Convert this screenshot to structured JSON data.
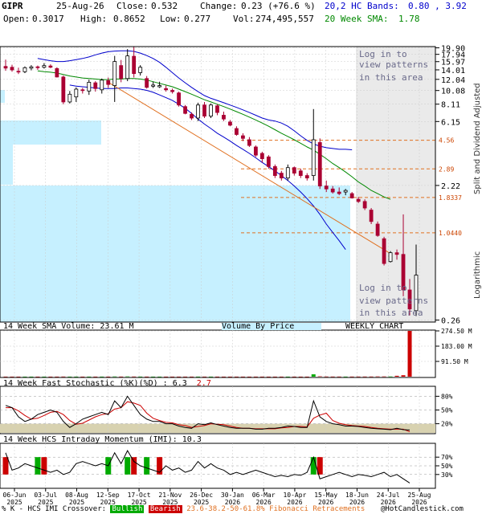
{
  "header": {
    "symbol": "GIPR",
    "date": "25-Aug-26",
    "close_label": "Close:",
    "close": "0.532",
    "change_label": "Change:",
    "change": "0.23 (+76.6 %)",
    "open_label": "Open:",
    "open": "0.3017",
    "high_label": "High:",
    "high": "0.8652",
    "low_label": "Low:",
    "low": "0.277",
    "vol_label": "Vol:",
    "vol": "274,495,557",
    "bands_label": "20,2 HC Bands:",
    "bands": "0.80 , 3.92",
    "sma_label": "20 Week SMA:",
    "sma": "1.78"
  },
  "overlay_text": {
    "login_top": [
      "Log in to",
      "view patterns",
      "in this area"
    ],
    "login_bottom": [
      "Log in to",
      "view patterns",
      "in this area"
    ]
  },
  "side_labels": {
    "adjusted": "Split and Dividend Adjusted",
    "log": "Logarithmic"
  },
  "panel_titles": {
    "volume": "14 Week SMA Volume: 23.61 M",
    "vbp": "Volume By Price",
    "weekly": "WEEKLY CHART",
    "stoch_prefix": "14 Week Fast Stochastic (%K)(%D) : ",
    "stoch_k": "6.3",
    "stoch_d": "2.7",
    "imi": "14 Week HCS Intraday Momentum (IMI): 10.3"
  },
  "footer": {
    "prefix": "% K - HCS IMI Crossover:",
    "bullish": "Bullish",
    "bearish": "Bearish",
    "fib": "23.6-38.2-50-61.8% Fibonacci Retracements",
    "copyright": "@HotCandlestick.com"
  },
  "colors": {
    "up": "#ffffff",
    "down": "#aa0033",
    "bands": "#0000cc",
    "sma": "#008800",
    "trend": "#e07020",
    "vbp": "#c6f0ff",
    "bullish": "#00aa00",
    "bearish": "#cc0000"
  },
  "chart_data": [
    {
      "type": "candlestick",
      "scale": "log",
      "price_ticks": [
        "19.90",
        "17.94",
        "15.97",
        "14.01",
        "12.04",
        "10.08",
        "8.11",
        "6.15",
        "2.22",
        "0.26"
      ],
      "price_tick_values": [
        19.9,
        17.94,
        15.97,
        14.01,
        12.04,
        10.08,
        8.11,
        6.15,
        2.22,
        0.26
      ],
      "fib_levels": [
        {
          "label": "4.56",
          "value": 4.56
        },
        {
          "label": "2.89",
          "value": 2.89
        },
        {
          "label": "1.8337",
          "value": 1.8337
        },
        {
          "label": "1.0440",
          "value": 1.044
        }
      ],
      "x_labels": [
        "06-Jun 2025",
        "03-Jul 2025",
        "08-Aug 2025",
        "12-Sep 2025",
        "17-Oct 2025",
        "21-Nov 2025",
        "26-Dec 2025",
        "30-Jan 2026",
        "06-Mar 2026",
        "10-Apr 2026",
        "15-May 2026",
        "18-Jun 2026",
        "24-Jul 2026",
        "25-Aug 2026"
      ],
      "candles": [
        {
          "o": 14.8,
          "h": 16.5,
          "l": 13.8,
          "c": 14.4
        },
        {
          "o": 14.6,
          "h": 15.2,
          "l": 13.6,
          "c": 14.0
        },
        {
          "o": 13.7,
          "h": 14.5,
          "l": 13.1,
          "c": 13.6
        },
        {
          "o": 13.6,
          "h": 14.8,
          "l": 13.3,
          "c": 14.5
        },
        {
          "o": 14.4,
          "h": 15.1,
          "l": 13.9,
          "c": 14.7
        },
        {
          "o": 14.7,
          "h": 15.0,
          "l": 14.0,
          "c": 14.5
        },
        {
          "o": 14.6,
          "h": 15.6,
          "l": 14.3,
          "c": 15.0
        },
        {
          "o": 14.9,
          "h": 15.3,
          "l": 14.4,
          "c": 14.6
        },
        {
          "o": 14.3,
          "h": 14.6,
          "l": 12.4,
          "c": 12.5
        },
        {
          "o": 12.5,
          "h": 12.8,
          "l": 8.1,
          "c": 8.4
        },
        {
          "o": 8.4,
          "h": 10.0,
          "l": 8.2,
          "c": 9.5
        },
        {
          "o": 9.1,
          "h": 10.6,
          "l": 8.4,
          "c": 10.3
        },
        {
          "o": 10.2,
          "h": 10.5,
          "l": 9.6,
          "c": 10.1
        },
        {
          "o": 10.0,
          "h": 12.0,
          "l": 9.4,
          "c": 11.5
        },
        {
          "o": 11.4,
          "h": 11.7,
          "l": 9.9,
          "c": 10.4
        },
        {
          "o": 10.2,
          "h": 12.2,
          "l": 9.6,
          "c": 11.9
        },
        {
          "o": 11.8,
          "h": 12.4,
          "l": 10.5,
          "c": 11.1
        },
        {
          "o": 10.9,
          "h": 17.5,
          "l": 8.4,
          "c": 16.0
        },
        {
          "o": 15.0,
          "h": 16.4,
          "l": 11.5,
          "c": 12.2
        },
        {
          "o": 12.2,
          "h": 19.5,
          "l": 11.7,
          "c": 17.5
        },
        {
          "o": 17.4,
          "h": 20.3,
          "l": 12.4,
          "c": 13.2
        },
        {
          "o": 13.4,
          "h": 15.1,
          "l": 12.8,
          "c": 14.6
        },
        {
          "o": 12.2,
          "h": 12.7,
          "l": 10.4,
          "c": 10.6
        },
        {
          "o": 10.8,
          "h": 11.6,
          "l": 10.5,
          "c": 11.0
        },
        {
          "o": 10.7,
          "h": 11.6,
          "l": 10.5,
          "c": 10.9
        },
        {
          "o": 10.4,
          "h": 10.9,
          "l": 9.9,
          "c": 10.2
        },
        {
          "o": 10.1,
          "h": 10.4,
          "l": 9.6,
          "c": 9.9
        },
        {
          "o": 9.7,
          "h": 9.9,
          "l": 7.8,
          "c": 8.0
        },
        {
          "o": 7.8,
          "h": 8.0,
          "l": 6.9,
          "c": 7.0
        },
        {
          "o": 6.9,
          "h": 7.1,
          "l": 6.3,
          "c": 6.5
        },
        {
          "o": 6.5,
          "h": 8.3,
          "l": 6.2,
          "c": 8.0
        },
        {
          "o": 8.0,
          "h": 8.4,
          "l": 6.5,
          "c": 6.7
        },
        {
          "o": 6.7,
          "h": 8.2,
          "l": 6.5,
          "c": 8.0
        },
        {
          "o": 7.9,
          "h": 8.1,
          "l": 6.8,
          "c": 7.1
        },
        {
          "o": 6.8,
          "h": 7.2,
          "l": 6.2,
          "c": 6.4
        },
        {
          "o": 6.1,
          "h": 6.3,
          "l": 5.7,
          "c": 5.8
        },
        {
          "o": 5.5,
          "h": 5.7,
          "l": 4.9,
          "c": 5.0
        },
        {
          "o": 4.9,
          "h": 5.1,
          "l": 4.5,
          "c": 4.7
        },
        {
          "o": 4.6,
          "h": 4.8,
          "l": 4.1,
          "c": 4.2
        },
        {
          "o": 4.1,
          "h": 4.2,
          "l": 3.5,
          "c": 3.6
        },
        {
          "o": 3.7,
          "h": 3.8,
          "l": 3.2,
          "c": 3.4
        },
        {
          "o": 3.5,
          "h": 3.6,
          "l": 2.9,
          "c": 3.0
        },
        {
          "o": 3.0,
          "h": 3.1,
          "l": 2.5,
          "c": 2.6
        },
        {
          "o": 2.7,
          "h": 2.8,
          "l": 2.4,
          "c": 2.5
        },
        {
          "o": 2.5,
          "h": 3.1,
          "l": 2.4,
          "c": 2.95
        },
        {
          "o": 2.95,
          "h": 3.0,
          "l": 2.6,
          "c": 2.7
        },
        {
          "o": 2.8,
          "h": 2.9,
          "l": 2.5,
          "c": 2.6
        },
        {
          "o": 2.6,
          "h": 2.7,
          "l": 2.4,
          "c": 2.5
        },
        {
          "o": 2.6,
          "h": 7.5,
          "l": 2.4,
          "c": 4.6
        },
        {
          "o": 4.4,
          "h": 4.7,
          "l": 2.1,
          "c": 2.2
        },
        {
          "o": 2.2,
          "h": 2.4,
          "l": 2.0,
          "c": 2.1
        },
        {
          "o": 2.1,
          "h": 2.2,
          "l": 1.95,
          "c": 2.0
        },
        {
          "o": 2.0,
          "h": 2.15,
          "l": 1.9,
          "c": 1.95
        },
        {
          "o": 2.0,
          "h": 2.1,
          "l": 1.9,
          "c": 2.05
        },
        {
          "o": 1.95,
          "h": 2.0,
          "l": 1.8,
          "c": 1.82
        },
        {
          "o": 1.78,
          "h": 1.85,
          "l": 1.68,
          "c": 1.72
        },
        {
          "o": 1.72,
          "h": 1.78,
          "l": 1.5,
          "c": 1.55
        },
        {
          "o": 1.5,
          "h": 1.55,
          "l": 1.2,
          "c": 1.25
        },
        {
          "o": 1.2,
          "h": 1.25,
          "l": 0.98,
          "c": 1.0
        },
        {
          "o": 0.95,
          "h": 0.98,
          "l": 0.62,
          "c": 0.64
        },
        {
          "o": 0.66,
          "h": 0.78,
          "l": 0.65,
          "c": 0.76
        },
        {
          "o": 0.76,
          "h": 0.8,
          "l": 0.68,
          "c": 0.74
        },
        {
          "o": 0.74,
          "h": 1.4,
          "l": 0.38,
          "c": 0.42
        },
        {
          "o": 0.42,
          "h": 0.5,
          "l": 0.28,
          "c": 0.31
        },
        {
          "o": 0.3017,
          "h": 0.8652,
          "l": 0.277,
          "c": 0.532
        }
      ],
      "sma20": [
        null,
        null,
        null,
        null,
        null,
        13.8,
        13.6,
        13.5,
        13.3,
        13.0,
        12.7,
        12.5,
        12.3,
        12.2,
        12.1,
        12.0,
        12.0,
        12.1,
        12.1,
        12.2,
        12.2,
        12.1,
        11.9,
        11.6,
        11.3,
        11.0,
        10.7,
        10.3,
        9.9,
        9.5,
        9.1,
        8.7,
        8.4,
        8.1,
        7.8,
        7.5,
        7.2,
        6.9,
        6.6,
        6.3,
        6.0,
        5.7,
        5.4,
        5.1,
        4.85,
        4.6,
        4.35,
        4.1,
        3.9,
        3.65,
        3.4,
        3.15,
        2.95,
        2.75,
        2.55,
        2.35,
        2.2,
        2.05,
        1.95,
        1.85,
        1.78
      ],
      "hc_upper": [
        null,
        null,
        null,
        null,
        null,
        16.8,
        16.5,
        16.2,
        16.0,
        16.0,
        16.2,
        16.5,
        16.8,
        17.2,
        17.8,
        18.3,
        18.7,
        18.9,
        19.0,
        19.0,
        18.8,
        18.3,
        17.6,
        16.8,
        15.8,
        14.6,
        13.4,
        12.3,
        11.4,
        10.6,
        9.9,
        9.3,
        8.9,
        8.6,
        8.3,
        8.0,
        7.7,
        7.4,
        7.1,
        6.8,
        6.5,
        6.3,
        6.2,
        6.0,
        5.7,
        5.3,
        4.9,
        4.55,
        4.3,
        4.15,
        4.05,
        4.0,
        3.95,
        3.95,
        3.92
      ],
      "hc_lower": [
        null,
        null,
        null,
        null,
        null,
        11.0,
        10.8,
        10.7,
        10.6,
        10.5,
        10.4,
        10.4,
        10.4,
        10.5,
        10.5,
        10.4,
        10.3,
        10.1,
        9.8,
        9.4,
        9.0,
        8.6,
        8.1,
        7.6,
        7.0,
        6.4,
        5.9,
        5.5,
        5.1,
        4.8,
        4.5,
        4.2,
        3.95,
        3.7,
        3.45,
        3.2,
        3.0,
        2.8,
        2.6,
        2.4,
        2.2,
        2.0,
        1.8,
        1.6,
        1.4,
        1.2,
        1.05,
        0.92,
        0.8
      ],
      "volume": [
        0.4,
        0.3,
        0.3,
        0.3,
        0.3,
        0.3,
        0.3,
        0.3,
        0.4,
        0.8,
        0.4,
        0.4,
        0.3,
        0.5,
        0.4,
        0.5,
        0.4,
        1.2,
        0.7,
        1.5,
        1.0,
        0.6,
        0.5,
        0.4,
        0.4,
        0.3,
        0.3,
        0.4,
        0.4,
        0.3,
        0.5,
        0.4,
        0.4,
        0.4,
        0.3,
        0.3,
        0.4,
        0.4,
        0.3,
        0.4,
        0.3,
        0.3,
        0.3,
        0.3,
        0.4,
        0.3,
        0.3,
        0.3,
        14.0,
        2.0,
        1.0,
        0.8,
        0.8,
        0.6,
        0.7,
        0.8,
        0.9,
        1.0,
        1.5,
        1.4,
        1.2,
        5.2,
        8.5,
        274.5
      ],
      "volume_ticks": [
        "274.50 M",
        "183.00 M",
        "91.50 M"
      ],
      "volume_tick_values": [
        274.5,
        183.0,
        91.5
      ],
      "stoch_k": [
        60,
        55,
        35,
        25,
        30,
        40,
        45,
        50,
        45,
        25,
        12,
        20,
        30,
        35,
        40,
        45,
        40,
        70,
        55,
        80,
        60,
        40,
        30,
        25,
        25,
        20,
        20,
        15,
        12,
        10,
        20,
        18,
        22,
        18,
        15,
        12,
        10,
        10,
        10,
        8,
        8,
        10,
        10,
        12,
        15,
        14,
        12,
        12,
        70,
        35,
        25,
        20,
        18,
        15,
        15,
        14,
        12,
        10,
        9,
        8,
        7,
        10,
        7,
        6.3
      ],
      "stoch_d": [
        55,
        55,
        48,
        38,
        30,
        32,
        38,
        45,
        47,
        40,
        27,
        19,
        21,
        28,
        35,
        40,
        42,
        52,
        55,
        68,
        65,
        60,
        43,
        32,
        27,
        23,
        22,
        18,
        16,
        12,
        14,
        16,
        20,
        19,
        18,
        15,
        12,
        10,
        10,
        9,
        9,
        9,
        9,
        11,
        12,
        14,
        14,
        13,
        32,
        39,
        43,
        27,
        21,
        18,
        16,
        15,
        14,
        12,
        10,
        9,
        8,
        8,
        8,
        2.7
      ],
      "stoch_ticks": [
        "80%",
        "50%",
        "20%"
      ],
      "imi": [
        80,
        40,
        45,
        55,
        50,
        45,
        40,
        35,
        40,
        30,
        35,
        55,
        60,
        55,
        50,
        55,
        50,
        80,
        55,
        85,
        60,
        50,
        45,
        40,
        35,
        50,
        40,
        45,
        35,
        40,
        60,
        45,
        55,
        45,
        40,
        30,
        35,
        30,
        35,
        40,
        35,
        30,
        25,
        28,
        25,
        30,
        28,
        35,
        70,
        20,
        25,
        30,
        35,
        30,
        25,
        30,
        28,
        25,
        30,
        35,
        25,
        30,
        20,
        10.3
      ],
      "imi_ticks": [
        "70%",
        "50%",
        "30%"
      ],
      "crossovers": [
        {
          "i": 0,
          "type": "bearish"
        },
        {
          "i": 5,
          "type": "bullish"
        },
        {
          "i": 6,
          "type": "bearish"
        },
        {
          "i": 16,
          "type": "bullish"
        },
        {
          "i": 19,
          "type": "bullish"
        },
        {
          "i": 20,
          "type": "bearish"
        },
        {
          "i": 22,
          "type": "bullish"
        },
        {
          "i": 24,
          "type": "bearish"
        },
        {
          "i": 48,
          "type": "bullish"
        },
        {
          "i": 49,
          "type": "bearish"
        }
      ]
    }
  ]
}
